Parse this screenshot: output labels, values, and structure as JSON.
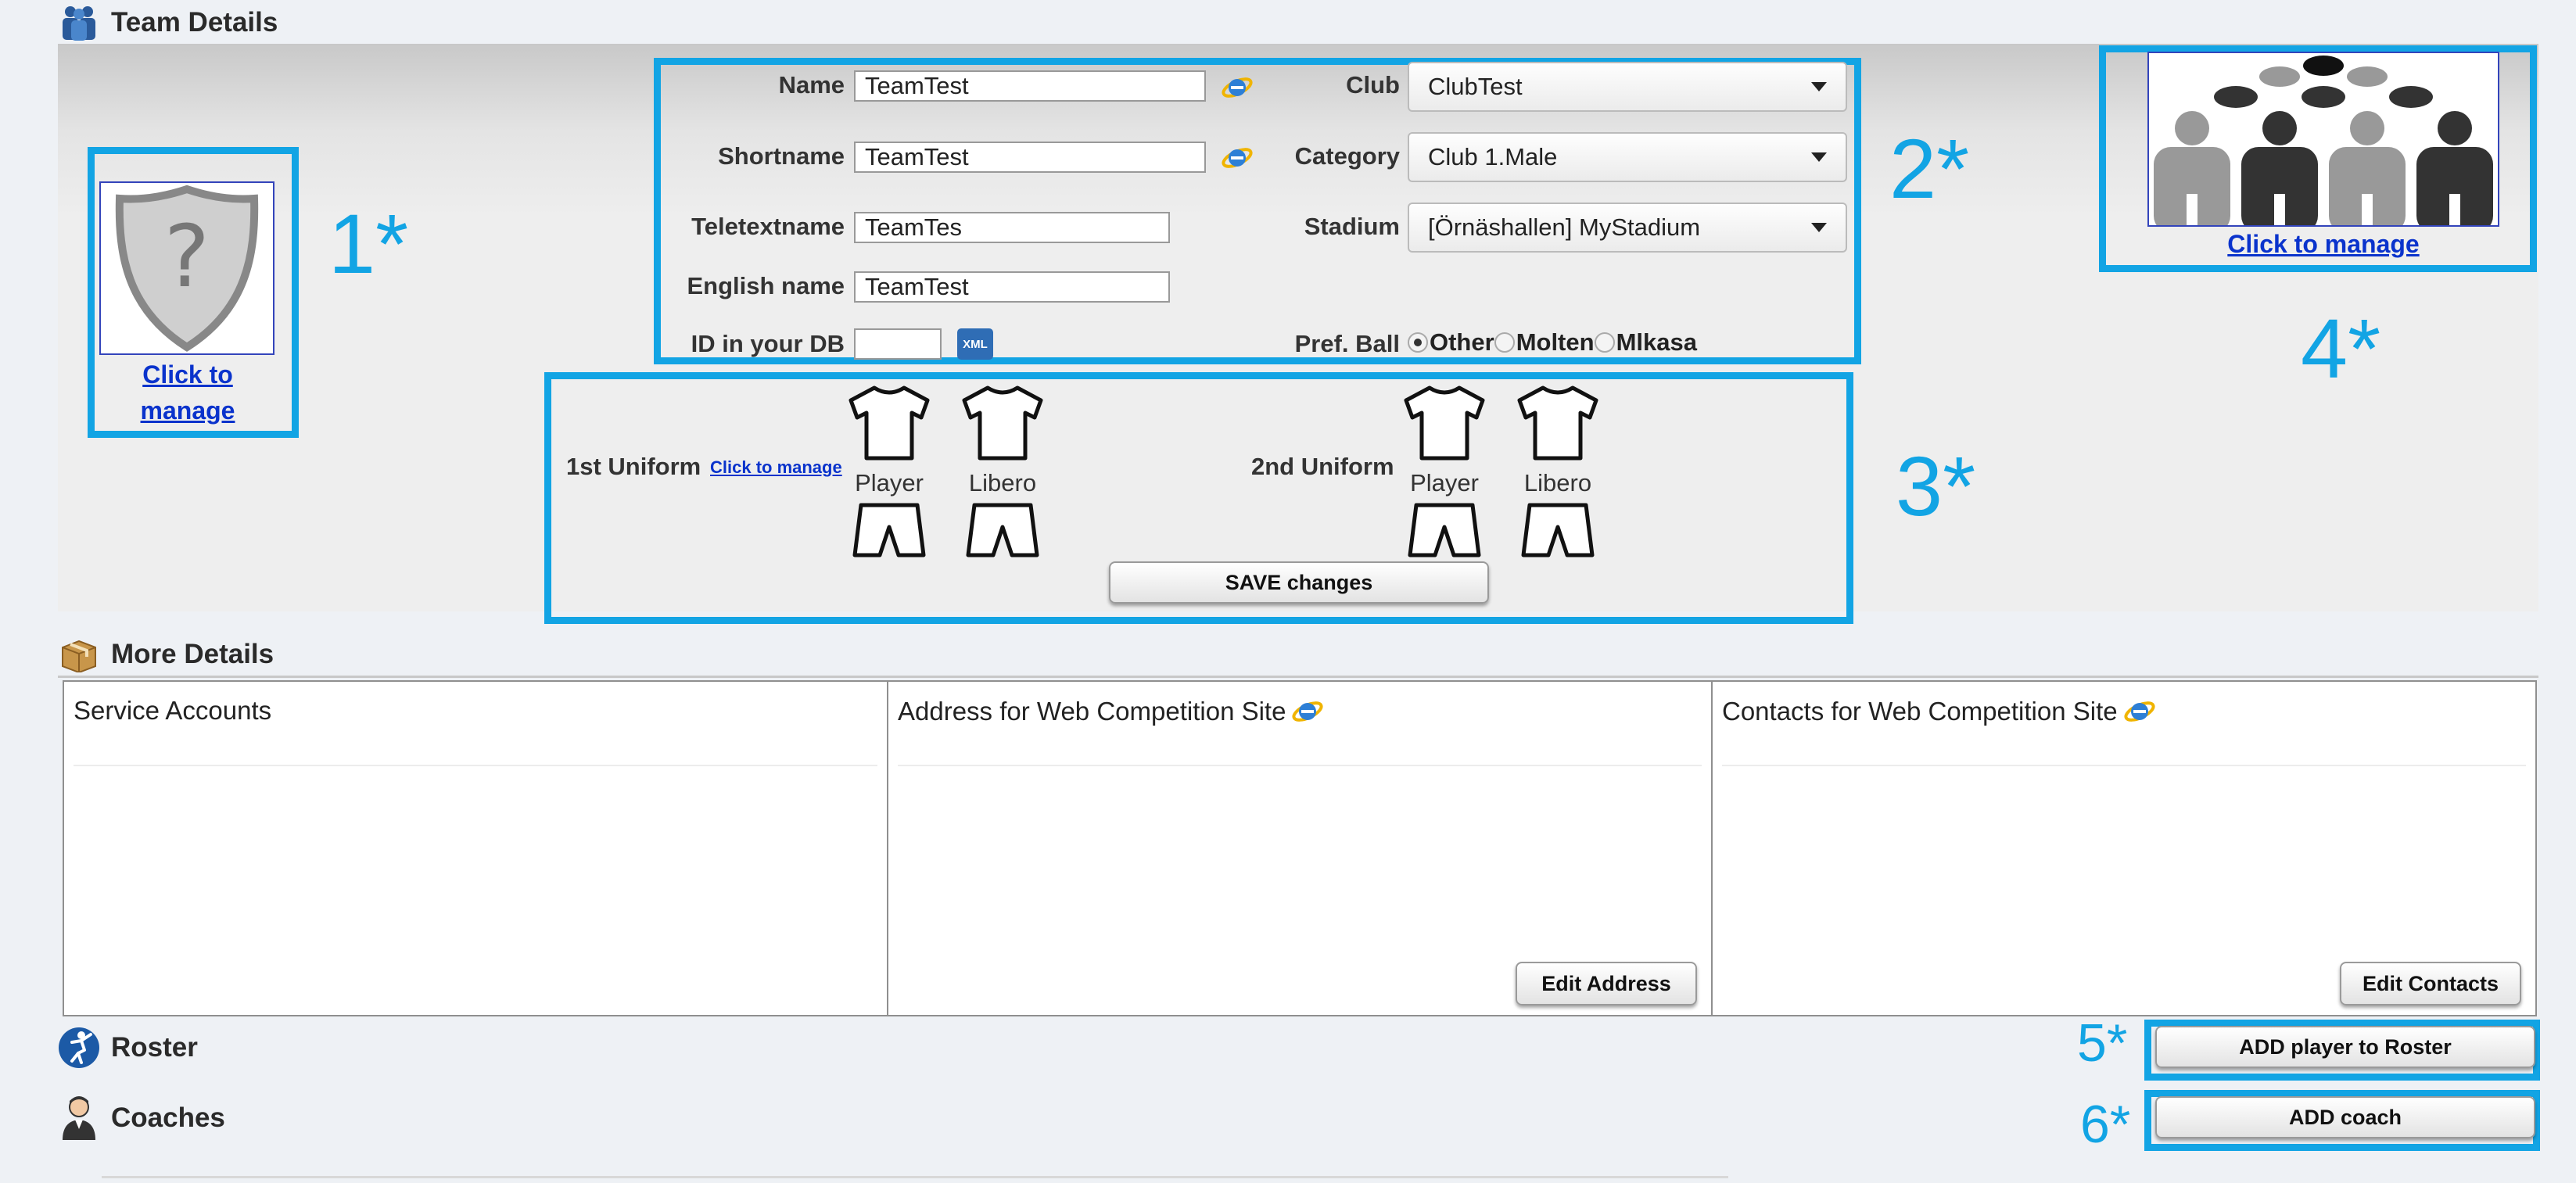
{
  "team_details": {
    "title": "Team Details",
    "icon": "team-icon",
    "logo": {
      "link": "Click to manage",
      "callout": "1*"
    },
    "form": {
      "callout": "2*",
      "name": {
        "label": "Name",
        "value": "TeamTest"
      },
      "shortname": {
        "label": "Shortname",
        "value": "TeamTest"
      },
      "teletextname": {
        "label": "Teletextname",
        "value": "TeamTes"
      },
      "english_name": {
        "label": "English name",
        "value": "TeamTest"
      },
      "id_db": {
        "label": "ID in your DB",
        "value": "",
        "badge": "XML"
      },
      "club": {
        "label": "Club",
        "value": "ClubTest"
      },
      "category": {
        "label": "Category",
        "value": "Club 1.Male"
      },
      "stadium": {
        "label": "Stadium",
        "value": "[Örnäshallen] MyStadium"
      },
      "pref_ball": {
        "label": "Pref. Ball",
        "options": [
          "Other",
          "Molten",
          "Mlkasa"
        ],
        "selected": "Other"
      }
    },
    "uniforms": {
      "callout": "3*",
      "first": {
        "label": "1st Uniform",
        "link": "Click to manage",
        "player": "Player",
        "libero": "Libero"
      },
      "second": {
        "label": "2nd Uniform",
        "player": "Player",
        "libero": "Libero"
      },
      "save_label": "SAVE changes"
    },
    "team_photo": {
      "link": "Click to manage",
      "callout": "4*"
    }
  },
  "more_details": {
    "title": "More Details",
    "icon": "box-icon",
    "service_accounts": {
      "title": "Service Accounts"
    },
    "address": {
      "title": "Address for Web Competition Site",
      "button": "Edit Address"
    },
    "contacts": {
      "title": "Contacts for Web Competition Site",
      "button": "Edit Contacts"
    }
  },
  "roster": {
    "title": "Roster",
    "icon": "volleyball-player-icon",
    "button": "ADD player to Roster",
    "callout": "5*"
  },
  "coaches": {
    "title": "Coaches",
    "icon": "coach-icon",
    "button": "ADD coach",
    "callout": "6*"
  },
  "colors": {
    "highlight": "#12a4e4",
    "link": "#0a33cc"
  }
}
